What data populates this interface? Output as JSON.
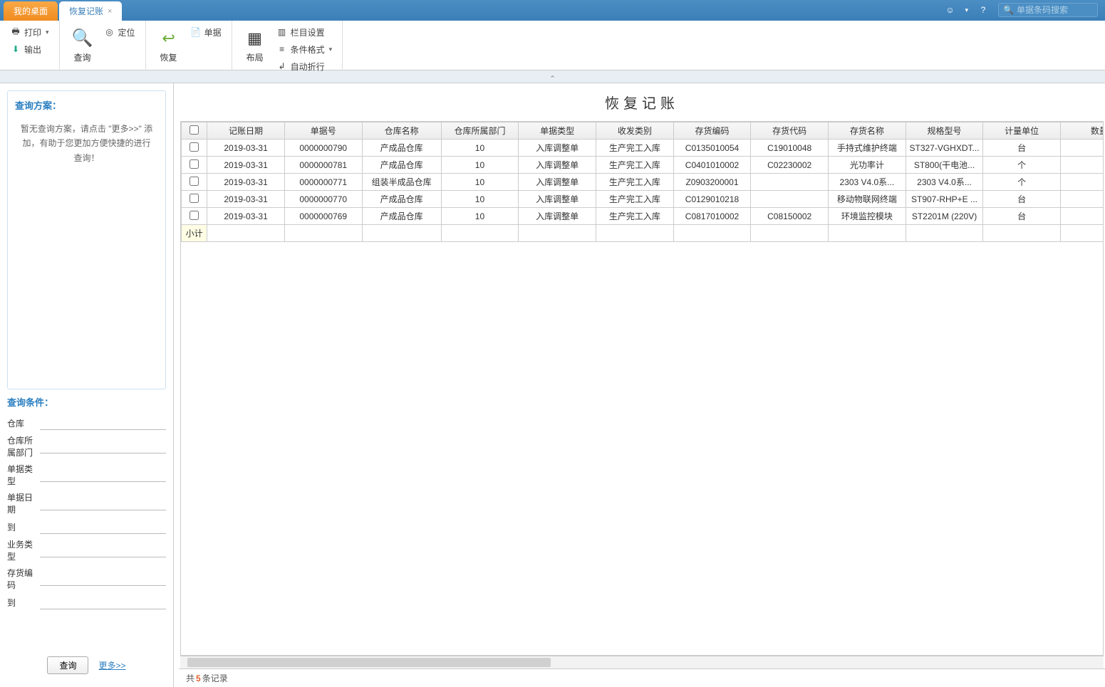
{
  "tabs": {
    "desktop": "我的桌面",
    "current": "恢复记账"
  },
  "search_placeholder": "单据条码搜索",
  "toolbar": {
    "print": "打印",
    "output": "输出",
    "query": "查询",
    "locate": "定位",
    "restore": "恢复",
    "voucher": "单据",
    "layout": "布局",
    "col_setting": "栏目设置",
    "cond_format": "条件格式",
    "auto_wrap": "自动折行"
  },
  "sidebar": {
    "plan_title": "查询方案：",
    "plan_empty": "暂无查询方案，请点击 \"更多>>\" 添加，有助于您更加方便快捷的进行查询！",
    "cond_title": "查询条件：",
    "fields": {
      "warehouse": "仓库",
      "dept": "仓库所属部门",
      "bill_type": "单据类型",
      "bill_date": "单据日期",
      "to1": "到",
      "biz_type": "业务类型",
      "inv_code": "存货编码",
      "to2": "到"
    },
    "query_btn": "查询",
    "more_link": "更多>>"
  },
  "page_title": "恢复记账",
  "columns": {
    "date": "记账日期",
    "doc": "单据号",
    "wh": "仓库名称",
    "dept": "仓库所属部门",
    "bill": "单据类型",
    "inout": "收发类别",
    "inv": "存货编码",
    "code": "存货代码",
    "name": "存货名称",
    "spec": "规格型号",
    "uom": "计量单位",
    "qty": "数量"
  },
  "rows": [
    {
      "date": "2019-03-31",
      "doc": "0000000790",
      "wh": "产成品仓库",
      "dept": "10",
      "bill": "入库调整单",
      "inout": "生产完工入库",
      "inv": "C0135010054",
      "code": "C19010048",
      "name": "手持式维护终端",
      "spec": "ST327-VGHXDT...",
      "uom": "台",
      "qty": ""
    },
    {
      "date": "2019-03-31",
      "doc": "0000000781",
      "wh": "产成品仓库",
      "dept": "10",
      "bill": "入库调整单",
      "inout": "生产完工入库",
      "inv": "C0401010002",
      "code": "C02230002",
      "name": "光功率计",
      "spec": "ST800(干电池...",
      "uom": "个",
      "qty": ""
    },
    {
      "date": "2019-03-31",
      "doc": "0000000771",
      "wh": "组装半成品仓库",
      "dept": "10",
      "bill": "入库调整单",
      "inout": "生产完工入库",
      "inv": "Z0903200001",
      "code": "",
      "name": "2303 V4.0系...",
      "spec": "2303 V4.0系...",
      "uom": "个",
      "qty": ""
    },
    {
      "date": "2019-03-31",
      "doc": "0000000770",
      "wh": "产成品仓库",
      "dept": "10",
      "bill": "入库调整单",
      "inout": "生产完工入库",
      "inv": "C0129010218",
      "code": "",
      "name": "移动物联网终端",
      "spec": "ST907-RHP+E ...",
      "uom": "台",
      "qty": ""
    },
    {
      "date": "2019-03-31",
      "doc": "0000000769",
      "wh": "产成品仓库",
      "dept": "10",
      "bill": "入库调整单",
      "inout": "生产完工入库",
      "inv": "C0817010002",
      "code": "C08150002",
      "name": "环境监控模块",
      "spec": "ST2201M (220V)",
      "uom": "台",
      "qty": ""
    }
  ],
  "subtotal": "小计",
  "status": {
    "prefix": "共",
    "count": "5",
    "suffix": "条记录"
  }
}
